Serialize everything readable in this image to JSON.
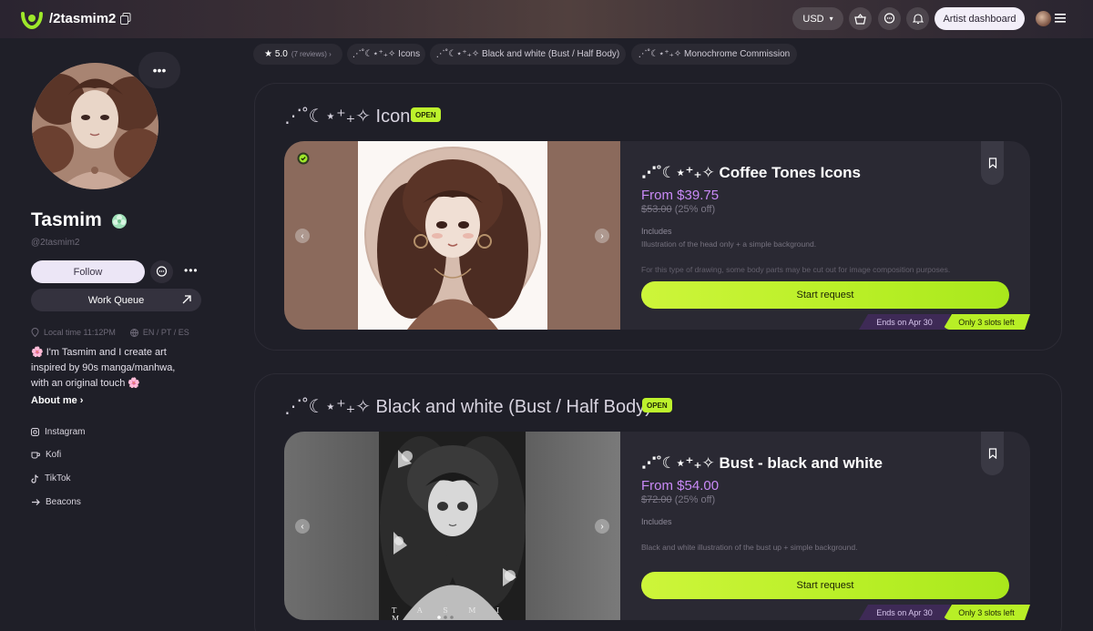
{
  "header": {
    "handle": "/2tasmim2",
    "currency": "USD",
    "dashboard_label": "Artist dashboard"
  },
  "profile": {
    "name": "Tasmim",
    "username": "@2tasmim2",
    "follow_label": "Follow",
    "work_queue_label": "Work Queue",
    "local_time": "Local time 11:12PM",
    "languages": "EN / PT / ES",
    "bio": "🌸 I'm Tasmim and I create art inspired by 90s manga/manhwa, with an original touch 🌸",
    "about_label": "About me ›",
    "socials": [
      {
        "icon": "instagram-icon",
        "label": "Instagram"
      },
      {
        "icon": "kofi-icon",
        "label": "Kofi"
      },
      {
        "icon": "tiktok-icon",
        "label": "TikTok"
      },
      {
        "icon": "beacons-icon",
        "label": "Beacons"
      }
    ]
  },
  "chips": [
    {
      "label": "★ 5.0",
      "sub": "(7 reviews) ›"
    },
    {
      "label": "⋰˚☾⋆⁺₊✧ Icons"
    },
    {
      "label": "⋰˚☾⋆⁺₊✧ Black and white (Bust / Half Body)"
    },
    {
      "label": "⋰˚☾⋆⁺₊✧ Monochrome Commission"
    }
  ],
  "sections": [
    {
      "title": "⋰˚☾⋆⁺₊✧ Icons",
      "status": "OPEN",
      "card": {
        "title": "⋰˚☾⋆⁺₊✧ Coffee Tones Icons",
        "price": "From $39.75",
        "old_price": "$53.00",
        "discount": "(25% off)",
        "includes_label": "Includes",
        "desc_1": "Illustration of the head only + a simple background.",
        "desc_2": "For this type of drawing, some body parts may be cut out for image composition purposes.",
        "cta": "Start request",
        "ends": "Ends on Apr 30",
        "slots": "Only 3 slots left"
      }
    },
    {
      "title": "⋰˚☾⋆⁺₊✧ Black and white (Bust / Half Body)",
      "status": "OPEN",
      "card": {
        "title": "⋰˚☾⋆⁺₊✧ Bust - black and white",
        "price": "From $54.00",
        "old_price": "$72.00",
        "discount": "(25% off)",
        "includes_label": "Includes",
        "desc_1": "Black and white illustration of the bust up + simple background.",
        "cta": "Start request",
        "ends": "Ends on Apr 30",
        "slots": "Only 3 slots left",
        "image_caption": "T A S M I M"
      }
    }
  ],
  "colors": {
    "accent_green": "#bdf22c",
    "price_purple": "#c98af7",
    "background": "#1f1f28"
  }
}
